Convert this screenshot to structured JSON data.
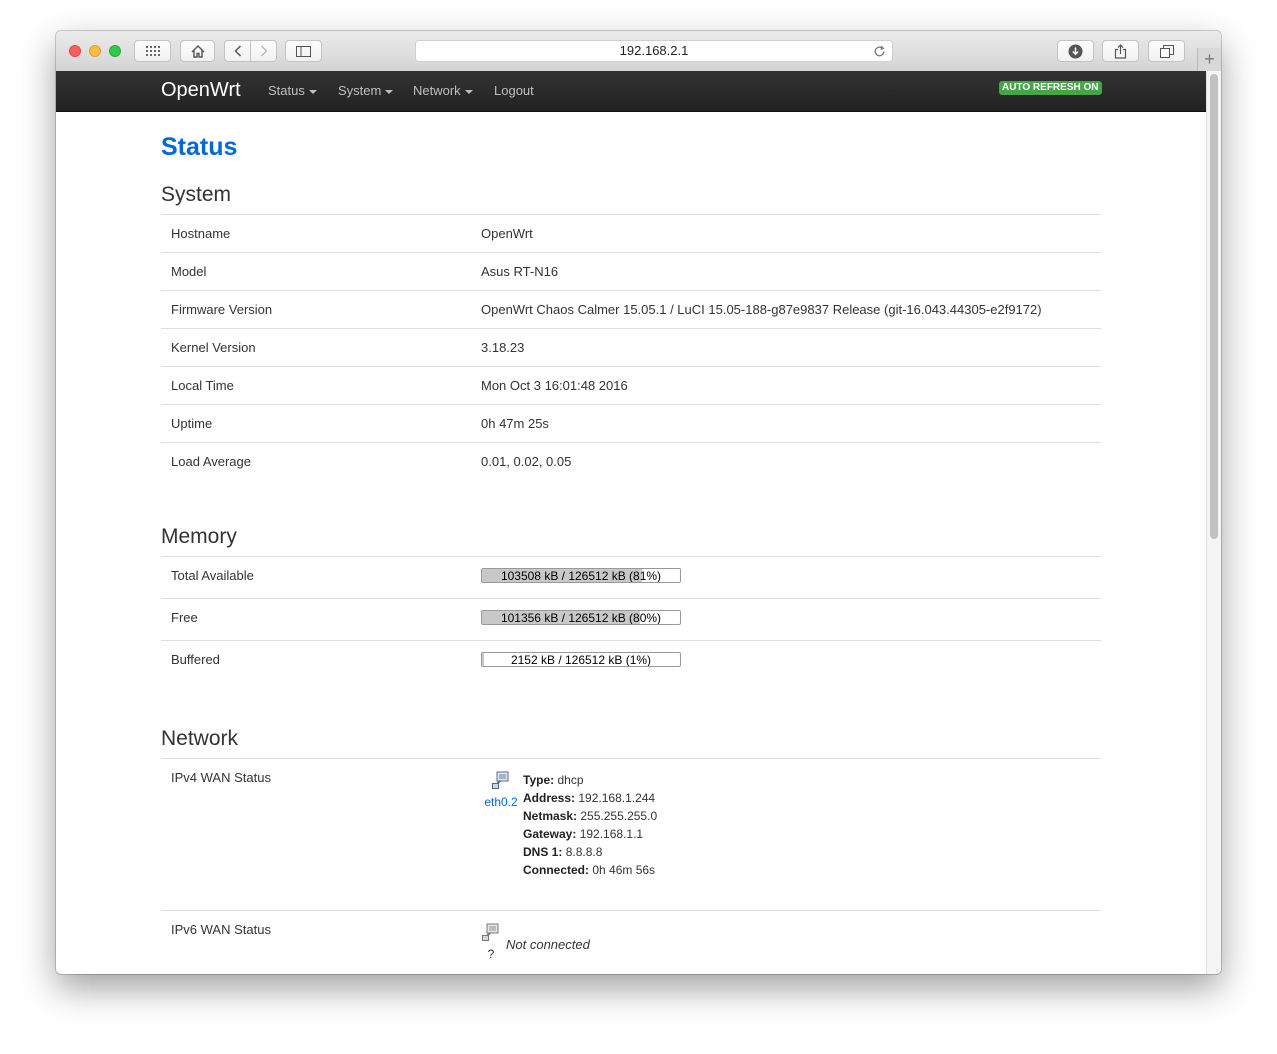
{
  "browser": {
    "url": "192.168.2.1",
    "new_tab_glyph": "+",
    "icons": [
      "grid-icon",
      "home-icon",
      "back-icon",
      "forward-icon",
      "sidebar-icon",
      "reload-icon",
      "download-icon",
      "share-icon",
      "tabs-icon"
    ]
  },
  "navbar": {
    "brand": "OpenWrt",
    "items": [
      {
        "label": "Status",
        "dropdown": true
      },
      {
        "label": "System",
        "dropdown": true
      },
      {
        "label": "Network",
        "dropdown": true
      },
      {
        "label": "Logout",
        "dropdown": false
      }
    ],
    "auto_refresh": "AUTO REFRESH ON",
    "auto_refresh_color": "#46a546"
  },
  "page": {
    "title": "Status",
    "title_color": "#0069d6"
  },
  "system": {
    "heading": "System",
    "rows": [
      {
        "label": "Hostname",
        "value": "OpenWrt"
      },
      {
        "label": "Model",
        "value": "Asus RT-N16"
      },
      {
        "label": "Firmware Version",
        "value": "OpenWrt Chaos Calmer 15.05.1 / LuCI 15.05-188-g87e9837 Release (git-16.043.44305-e2f9172)"
      },
      {
        "label": "Kernel Version",
        "value": "3.18.23"
      },
      {
        "label": "Local Time",
        "value": "Mon Oct 3 16:01:48 2016"
      },
      {
        "label": "Uptime",
        "value": "0h 47m 25s"
      },
      {
        "label": "Load Average",
        "value": "0.01, 0.02, 0.05"
      }
    ]
  },
  "memory": {
    "heading": "Memory",
    "rows": [
      {
        "label": "Total Available",
        "text": "103508 kB / 126512 kB (81%)",
        "percent": 81
      },
      {
        "label": "Free",
        "text": "101356 kB / 126512 kB (80%)",
        "percent": 80
      },
      {
        "label": "Buffered",
        "text": "2152 kB / 126512 kB (1%)",
        "percent": 1
      }
    ]
  },
  "network": {
    "heading": "Network",
    "ipv4": {
      "label": "IPv4 WAN Status",
      "interface": "eth0.2",
      "type_label": "Type:",
      "type": "dhcp",
      "address_label": "Address:",
      "address": "192.168.1.244",
      "netmask_label": "Netmask:",
      "netmask": "255.255.255.0",
      "gateway_label": "Gateway:",
      "gateway": "192.168.1.1",
      "dns_label": "DNS 1:",
      "dns": "8.8.8.8",
      "connected_label": "Connected:",
      "connected": "0h 46m 56s"
    },
    "ipv6": {
      "label": "IPv6 WAN Status",
      "interface": "?",
      "status": "Not connected"
    }
  }
}
